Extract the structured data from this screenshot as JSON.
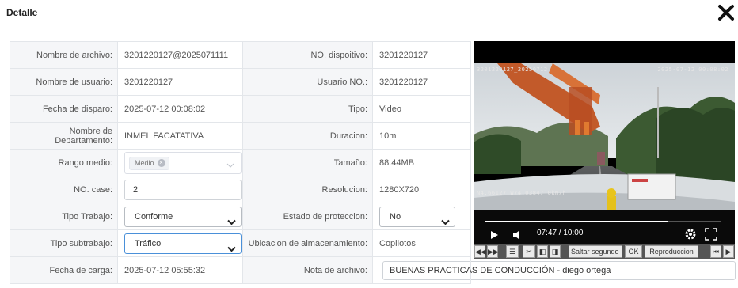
{
  "dialog": {
    "title": "Detalle"
  },
  "fields": {
    "file_name": {
      "label": "Nombre de archivo:",
      "value": "3201220127@2025071111"
    },
    "device_no": {
      "label": "NO. dispoitivo:",
      "value": "3201220127"
    },
    "user_name": {
      "label": "Nombre de usuario:",
      "value": "3201220127"
    },
    "user_no": {
      "label": "Usuario NO.:",
      "value": "3201220127"
    },
    "trigger_date": {
      "label": "Fecha de disparo:",
      "value": "2025-07-12 00:08:02"
    },
    "type": {
      "label": "Tipo:",
      "value": "Video"
    },
    "department": {
      "label": "Nombre de Departamento:",
      "value": "INMEL FACATATIVA"
    },
    "duration": {
      "label": "Duracion:",
      "value": "10m"
    },
    "range": {
      "label": "Rango medio:",
      "tag": "Medio"
    },
    "size": {
      "label": "Tamaño:",
      "value": "88.44MB"
    },
    "case_no": {
      "label": "NO. case:",
      "value": "2"
    },
    "resolution": {
      "label": "Resolucion:",
      "value": "1280X720"
    },
    "work_type": {
      "label": "Tipo Trabajo:",
      "value": "Conforme"
    },
    "protection": {
      "label": "Estado de proteccion:",
      "value": "No"
    },
    "work_subtype": {
      "label": "Tipo subtrabajo:",
      "value": "Tráfico"
    },
    "storage": {
      "label": "Ubicacion de almacenamiento:",
      "value": "Copilotos"
    },
    "upload_date": {
      "label": "Fecha de carga:",
      "value": "2025-07-12 05:55:32"
    },
    "file_note": {
      "label": "Nota de archivo:",
      "value": "BUENAS PRACTICAS DE CONDUCCIÓN - diego ortega"
    }
  },
  "player": {
    "time": "07:47 / 10:00",
    "progress": 0.778,
    "osd_left": "3201220127_20250712",
    "osd_right": "2025-07-12 00:08:02",
    "osd_bottom": "N4.66127 W74.03847 0km/h",
    "toolbar": {
      "seek_label": "Saltar segundo",
      "ok_label": "OK",
      "play_label": "Reproduccion"
    }
  },
  "colors": {
    "accent": "#4a90d9",
    "label_bg": "#f5f6f8",
    "border": "#e3e6ea"
  }
}
